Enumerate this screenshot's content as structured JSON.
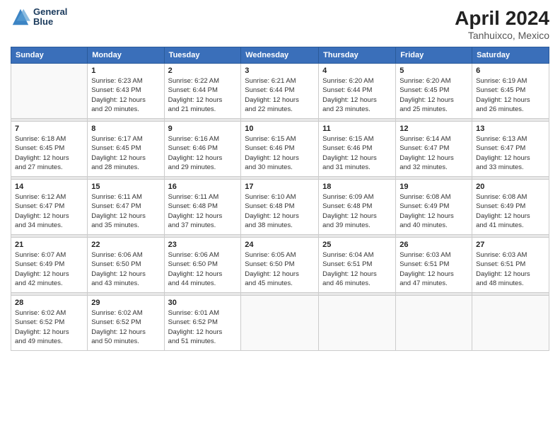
{
  "header": {
    "logo_line1": "General",
    "logo_line2": "Blue",
    "main_title": "April 2024",
    "subtitle": "Tanhuixco, Mexico"
  },
  "days_of_week": [
    "Sunday",
    "Monday",
    "Tuesday",
    "Wednesday",
    "Thursday",
    "Friday",
    "Saturday"
  ],
  "weeks": [
    [
      {
        "num": "",
        "info": ""
      },
      {
        "num": "1",
        "info": "Sunrise: 6:23 AM\nSunset: 6:43 PM\nDaylight: 12 hours\nand 20 minutes."
      },
      {
        "num": "2",
        "info": "Sunrise: 6:22 AM\nSunset: 6:44 PM\nDaylight: 12 hours\nand 21 minutes."
      },
      {
        "num": "3",
        "info": "Sunrise: 6:21 AM\nSunset: 6:44 PM\nDaylight: 12 hours\nand 22 minutes."
      },
      {
        "num": "4",
        "info": "Sunrise: 6:20 AM\nSunset: 6:44 PM\nDaylight: 12 hours\nand 23 minutes."
      },
      {
        "num": "5",
        "info": "Sunrise: 6:20 AM\nSunset: 6:45 PM\nDaylight: 12 hours\nand 25 minutes."
      },
      {
        "num": "6",
        "info": "Sunrise: 6:19 AM\nSunset: 6:45 PM\nDaylight: 12 hours\nand 26 minutes."
      }
    ],
    [
      {
        "num": "7",
        "info": "Sunrise: 6:18 AM\nSunset: 6:45 PM\nDaylight: 12 hours\nand 27 minutes."
      },
      {
        "num": "8",
        "info": "Sunrise: 6:17 AM\nSunset: 6:45 PM\nDaylight: 12 hours\nand 28 minutes."
      },
      {
        "num": "9",
        "info": "Sunrise: 6:16 AM\nSunset: 6:46 PM\nDaylight: 12 hours\nand 29 minutes."
      },
      {
        "num": "10",
        "info": "Sunrise: 6:15 AM\nSunset: 6:46 PM\nDaylight: 12 hours\nand 30 minutes."
      },
      {
        "num": "11",
        "info": "Sunrise: 6:15 AM\nSunset: 6:46 PM\nDaylight: 12 hours\nand 31 minutes."
      },
      {
        "num": "12",
        "info": "Sunrise: 6:14 AM\nSunset: 6:47 PM\nDaylight: 12 hours\nand 32 minutes."
      },
      {
        "num": "13",
        "info": "Sunrise: 6:13 AM\nSunset: 6:47 PM\nDaylight: 12 hours\nand 33 minutes."
      }
    ],
    [
      {
        "num": "14",
        "info": "Sunrise: 6:12 AM\nSunset: 6:47 PM\nDaylight: 12 hours\nand 34 minutes."
      },
      {
        "num": "15",
        "info": "Sunrise: 6:11 AM\nSunset: 6:47 PM\nDaylight: 12 hours\nand 35 minutes."
      },
      {
        "num": "16",
        "info": "Sunrise: 6:11 AM\nSunset: 6:48 PM\nDaylight: 12 hours\nand 37 minutes."
      },
      {
        "num": "17",
        "info": "Sunrise: 6:10 AM\nSunset: 6:48 PM\nDaylight: 12 hours\nand 38 minutes."
      },
      {
        "num": "18",
        "info": "Sunrise: 6:09 AM\nSunset: 6:48 PM\nDaylight: 12 hours\nand 39 minutes."
      },
      {
        "num": "19",
        "info": "Sunrise: 6:08 AM\nSunset: 6:49 PM\nDaylight: 12 hours\nand 40 minutes."
      },
      {
        "num": "20",
        "info": "Sunrise: 6:08 AM\nSunset: 6:49 PM\nDaylight: 12 hours\nand 41 minutes."
      }
    ],
    [
      {
        "num": "21",
        "info": "Sunrise: 6:07 AM\nSunset: 6:49 PM\nDaylight: 12 hours\nand 42 minutes."
      },
      {
        "num": "22",
        "info": "Sunrise: 6:06 AM\nSunset: 6:50 PM\nDaylight: 12 hours\nand 43 minutes."
      },
      {
        "num": "23",
        "info": "Sunrise: 6:06 AM\nSunset: 6:50 PM\nDaylight: 12 hours\nand 44 minutes."
      },
      {
        "num": "24",
        "info": "Sunrise: 6:05 AM\nSunset: 6:50 PM\nDaylight: 12 hours\nand 45 minutes."
      },
      {
        "num": "25",
        "info": "Sunrise: 6:04 AM\nSunset: 6:51 PM\nDaylight: 12 hours\nand 46 minutes."
      },
      {
        "num": "26",
        "info": "Sunrise: 6:03 AM\nSunset: 6:51 PM\nDaylight: 12 hours\nand 47 minutes."
      },
      {
        "num": "27",
        "info": "Sunrise: 6:03 AM\nSunset: 6:51 PM\nDaylight: 12 hours\nand 48 minutes."
      }
    ],
    [
      {
        "num": "28",
        "info": "Sunrise: 6:02 AM\nSunset: 6:52 PM\nDaylight: 12 hours\nand 49 minutes."
      },
      {
        "num": "29",
        "info": "Sunrise: 6:02 AM\nSunset: 6:52 PM\nDaylight: 12 hours\nand 50 minutes."
      },
      {
        "num": "30",
        "info": "Sunrise: 6:01 AM\nSunset: 6:52 PM\nDaylight: 12 hours\nand 51 minutes."
      },
      {
        "num": "",
        "info": ""
      },
      {
        "num": "",
        "info": ""
      },
      {
        "num": "",
        "info": ""
      },
      {
        "num": "",
        "info": ""
      }
    ]
  ]
}
